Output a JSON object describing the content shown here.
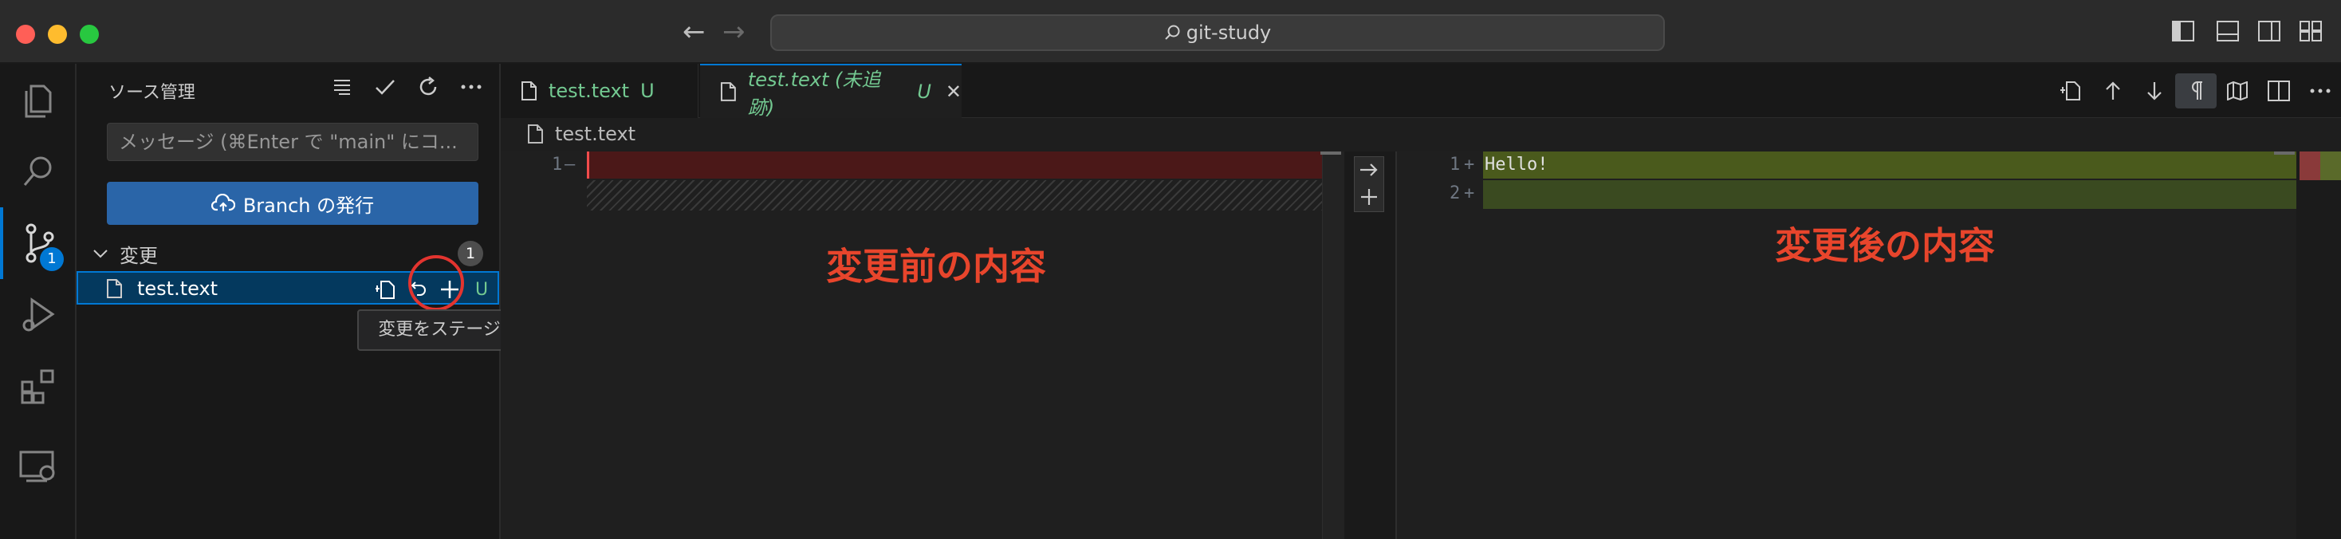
{
  "window": {
    "search_text": "git-study"
  },
  "activity_bar": {
    "items": [
      {
        "name": "explorer",
        "icon": "files-icon"
      },
      {
        "name": "search",
        "icon": "search-icon"
      },
      {
        "name": "source-control",
        "icon": "source-control-icon",
        "badge": "1"
      },
      {
        "name": "run-debug",
        "icon": "debug-icon"
      },
      {
        "name": "extensions",
        "icon": "extensions-icon"
      },
      {
        "name": "remote",
        "icon": "remote-icon"
      }
    ]
  },
  "sidebar": {
    "title": "ソース管理",
    "commit_message_placeholder": "メッセージ (⌘Enter で \"main\" にコ...",
    "publish_label": "Branch の発行",
    "changes_section": {
      "label": "変更",
      "count": "1"
    },
    "file": {
      "name": "test.text",
      "status": "U"
    },
    "tooltip": "変更をステージ"
  },
  "tabs": [
    {
      "label": "test.text",
      "status": "U"
    },
    {
      "label": "test.text (未追跡)",
      "status": "U",
      "close": "✕"
    }
  ],
  "breadcrumb": {
    "file": "test.text"
  },
  "diff": {
    "left": {
      "lines": [
        {
          "num": "1",
          "marker": "—"
        }
      ],
      "annotation": "変更前の内容"
    },
    "right": {
      "lines": [
        {
          "num": "1",
          "marker": "+",
          "text": "Hello!"
        },
        {
          "num": "2",
          "marker": "+",
          "text": ""
        }
      ],
      "annotation": "変更後の内容"
    }
  },
  "colors": {
    "accent": "#0078d4",
    "deleted_bg": "#4b1818",
    "added_bg": "#4a5a1c",
    "annotation": "#e8452c",
    "untracked": "#73c991"
  }
}
